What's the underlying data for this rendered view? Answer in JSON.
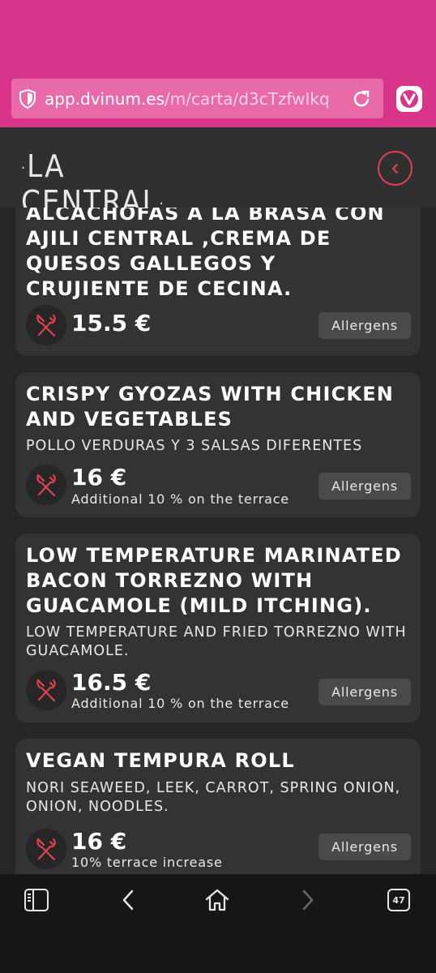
{
  "browser": {
    "url_host": "app.dvinum.es",
    "url_path": "/m/carta/d3cTzfwIkq",
    "tab_count": "47"
  },
  "header": {
    "logo_text": "LA CENTRAL"
  },
  "items": [
    {
      "name": "ALCACHOFAS A LA BRASA CON AJILI CENTRAL ,CREMA DE QUESOS GALLEGOS Y CRUJIENTE DE CECINA.",
      "description": "",
      "price": "15.5 €",
      "note": "",
      "allergens_label": "Allergens"
    },
    {
      "name": "CRISPY GYOZAS WITH CHICKEN AND VEGETABLES",
      "description": "POLLO VERDURAS Y 3 SALSAS DIFERENTES",
      "price": "16 €",
      "note": "Additional 10 % on the terrace",
      "allergens_label": "Allergens"
    },
    {
      "name": "LOW TEMPERATURE MARINATED BACON TORREZNO WITH GUACAMOLE (MILD ITCHING).",
      "description": "LOW TEMPERATURE AND FRIED TORREZNO WITH GUACAMOLE.",
      "price": "16.5 €",
      "note": "Additional 10 % on the terrace",
      "allergens_label": "Allergens"
    },
    {
      "name": "VEGAN TEMPURA ROLL",
      "description": "NORI SEAWEED, LEEK, CARROT, SPRING ONION, ONION, NOODLES.",
      "price": "16 €",
      "note": "10% terrace increase",
      "allergens_label": "Allergens"
    }
  ],
  "colors": {
    "browser_accent": "#d8358a",
    "urlbar_bg": "#e86aa9",
    "page_bg": "#262626",
    "card_bg": "#333333",
    "icon_accent": "#e0414f"
  }
}
